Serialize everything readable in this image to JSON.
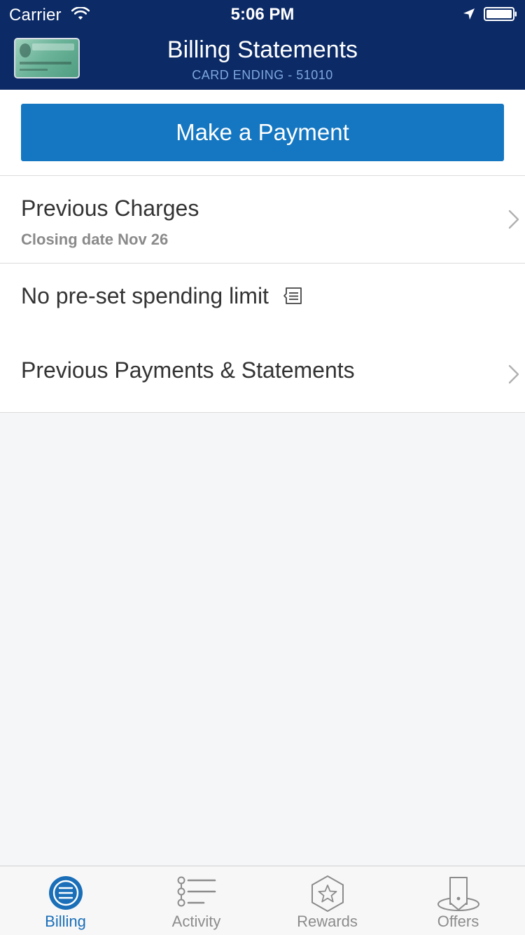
{
  "status_bar": {
    "carrier": "Carrier",
    "time": "5:06 PM",
    "icons": [
      "wifi-icon",
      "location-arrow-icon",
      "battery-icon"
    ]
  },
  "header": {
    "title": "Billing Statements",
    "subtitle": "CARD ENDING - 51010",
    "card_image": "business-card-thumbnail"
  },
  "actions": {
    "make_payment_label": "Make a Payment"
  },
  "rows": {
    "previous_charges": {
      "title": "Previous Charges",
      "subtitle": "Closing date Nov 26"
    },
    "spending_limit": {
      "title": "No pre-set spending limit",
      "icon": "note-icon"
    },
    "previous_payments": {
      "title": "Previous Payments & Statements"
    }
  },
  "tab_bar": {
    "tabs": [
      {
        "label": "Billing",
        "icon": "billing-icon",
        "active": true
      },
      {
        "label": "Activity",
        "icon": "activity-list-icon",
        "active": false
      },
      {
        "label": "Rewards",
        "icon": "rewards-star-icon",
        "active": false
      },
      {
        "label": "Offers",
        "icon": "offers-tag-icon",
        "active": false
      }
    ]
  },
  "colors": {
    "header_bg": "#0b2a66",
    "primary_button": "#1577c1",
    "active_tab": "#1a6fb8",
    "inactive_tab": "#8c8c8c",
    "subtitle": "#7ea7de"
  }
}
